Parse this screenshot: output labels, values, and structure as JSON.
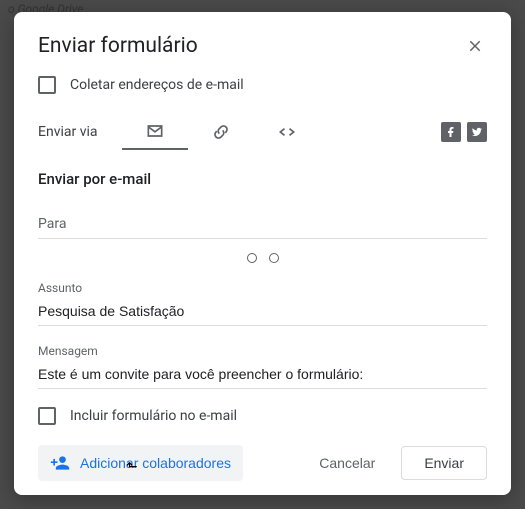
{
  "background": {
    "text": "o Google Drive"
  },
  "modal": {
    "title": "Enviar formulário",
    "collect_label": "Coletar endereços de e-mail",
    "send_via_label": "Enviar via",
    "section_title": "Enviar por e-mail",
    "to_label": "Para",
    "subject_label": "Assunto",
    "subject_value": "Pesquisa de Satisfação",
    "message_label": "Mensagem",
    "message_value": "Este é um convite para você preencher o formulário:",
    "include_label": "Incluir formulário no e-mail",
    "collab_label": "Adicionar colaboradores",
    "cancel_label": "Cancelar",
    "send_label": "Enviar"
  }
}
